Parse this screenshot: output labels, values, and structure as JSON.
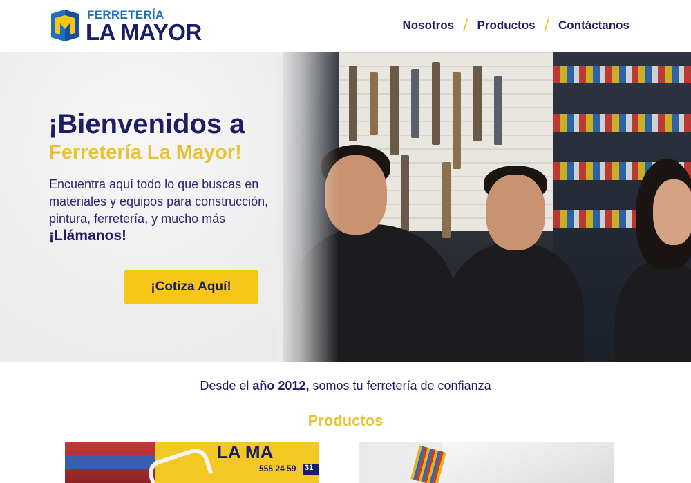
{
  "brand": {
    "logo_top": "FERRETERÍA",
    "logo_bottom": "LA MAYOR",
    "logo_icon": "hardware-store-logo-icon",
    "colors": {
      "navy": "#1f1d63",
      "yellow": "#f5c518",
      "blue": "#1f6fbf"
    }
  },
  "nav": {
    "items": [
      {
        "label": "Nosotros"
      },
      {
        "label": "Productos"
      },
      {
        "label": "Contáctanos"
      }
    ],
    "separator": "/"
  },
  "hero": {
    "title_line1": "¡Bienvenidos a",
    "title_line2": "Ferretería La Mayor!",
    "description": "Encuentra aquí todo lo que buscas en materiales y equipos para construcción, pintura, ferretería, y mucho más",
    "call_to_action_text": "¡Llámanos!",
    "button_label": "¡Cotiza Aquí!"
  },
  "tagline": {
    "prefix": "Desde el ",
    "highlight": "año 2012,",
    "suffix": " somos tu ferretería de confianza"
  },
  "products": {
    "section_title": "Productos",
    "card1_sign": "LA MA",
    "card1_phone": "555 24 59",
    "card1_phone2": "31"
  }
}
